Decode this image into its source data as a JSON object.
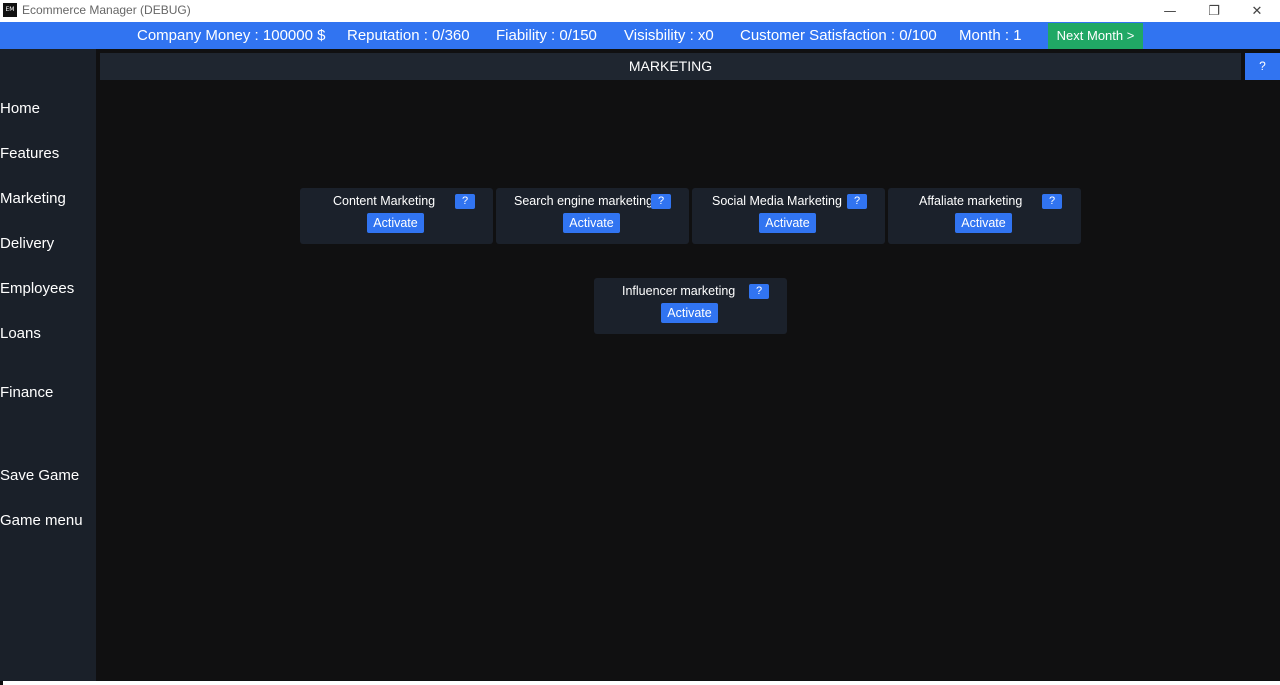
{
  "window": {
    "icon_text": "EM",
    "title": "Ecommerce Manager (DEBUG)",
    "minimize_glyph": "—",
    "restore_glyph": "❐",
    "close_glyph": "✕"
  },
  "status": {
    "company_money": "Company Money : 100000 $",
    "reputation": "Reputation : 0/360",
    "fiability": "Fiability : 0/150",
    "visibility": "Visisbility : x0",
    "customer_satisfaction": "Customer Satisfaction : 0/100",
    "month": "Month : 1",
    "next_month": "Next Month >"
  },
  "sidebar": {
    "items": [
      {
        "label": "Home"
      },
      {
        "label": "Features"
      },
      {
        "label": "Marketing"
      },
      {
        "label": "Delivery"
      },
      {
        "label": "Employees"
      },
      {
        "label": "Loans"
      },
      {
        "label": "Finance"
      },
      {
        "label": "Save Game"
      },
      {
        "label": "Game menu"
      }
    ]
  },
  "header": {
    "title": "MARKETING",
    "help": "?"
  },
  "cards": [
    {
      "title": "Content Marketing",
      "help": "?",
      "button": "Activate"
    },
    {
      "title": "Search engine marketing",
      "help": "?",
      "button": "Activate"
    },
    {
      "title": "Social Media Marketing",
      "help": "?",
      "button": "Activate"
    },
    {
      "title": "Affaliate marketing",
      "help": "?",
      "button": "Activate"
    },
    {
      "title": "Influencer marketing",
      "help": "?",
      "button": "Activate"
    }
  ],
  "colors": {
    "accent_blue": "#3174f1",
    "next_month_green": "#20a865",
    "background": "#101011",
    "sidebar": "#1a2029",
    "card": "#1b212b"
  }
}
